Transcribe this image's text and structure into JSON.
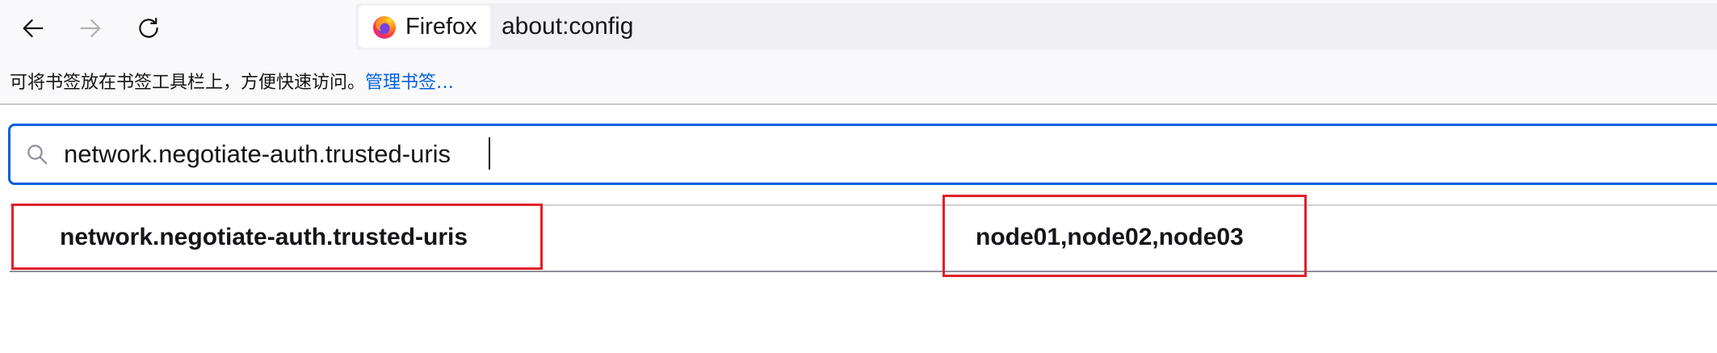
{
  "toolbar": {
    "back_icon": "arrow-left-icon",
    "forward_icon": "arrow-right-icon",
    "reload_icon": "reload-icon",
    "identity_label": "Firefox",
    "url": "about:config"
  },
  "bookmarks_bar": {
    "hint": "可将书签放在书签工具栏上，方便快速访问。",
    "manage_link": "管理书签…"
  },
  "search": {
    "value": "network.negotiate-auth.trusted-uris"
  },
  "preferences": [
    {
      "name": "network.negotiate-auth.trusted-uris",
      "value": "node01,node02,node03",
      "highlighted": true
    }
  ],
  "colors": {
    "accent": "#0060df",
    "highlight": "#e0202a",
    "toolbar_bg": "#f9f9fb"
  }
}
